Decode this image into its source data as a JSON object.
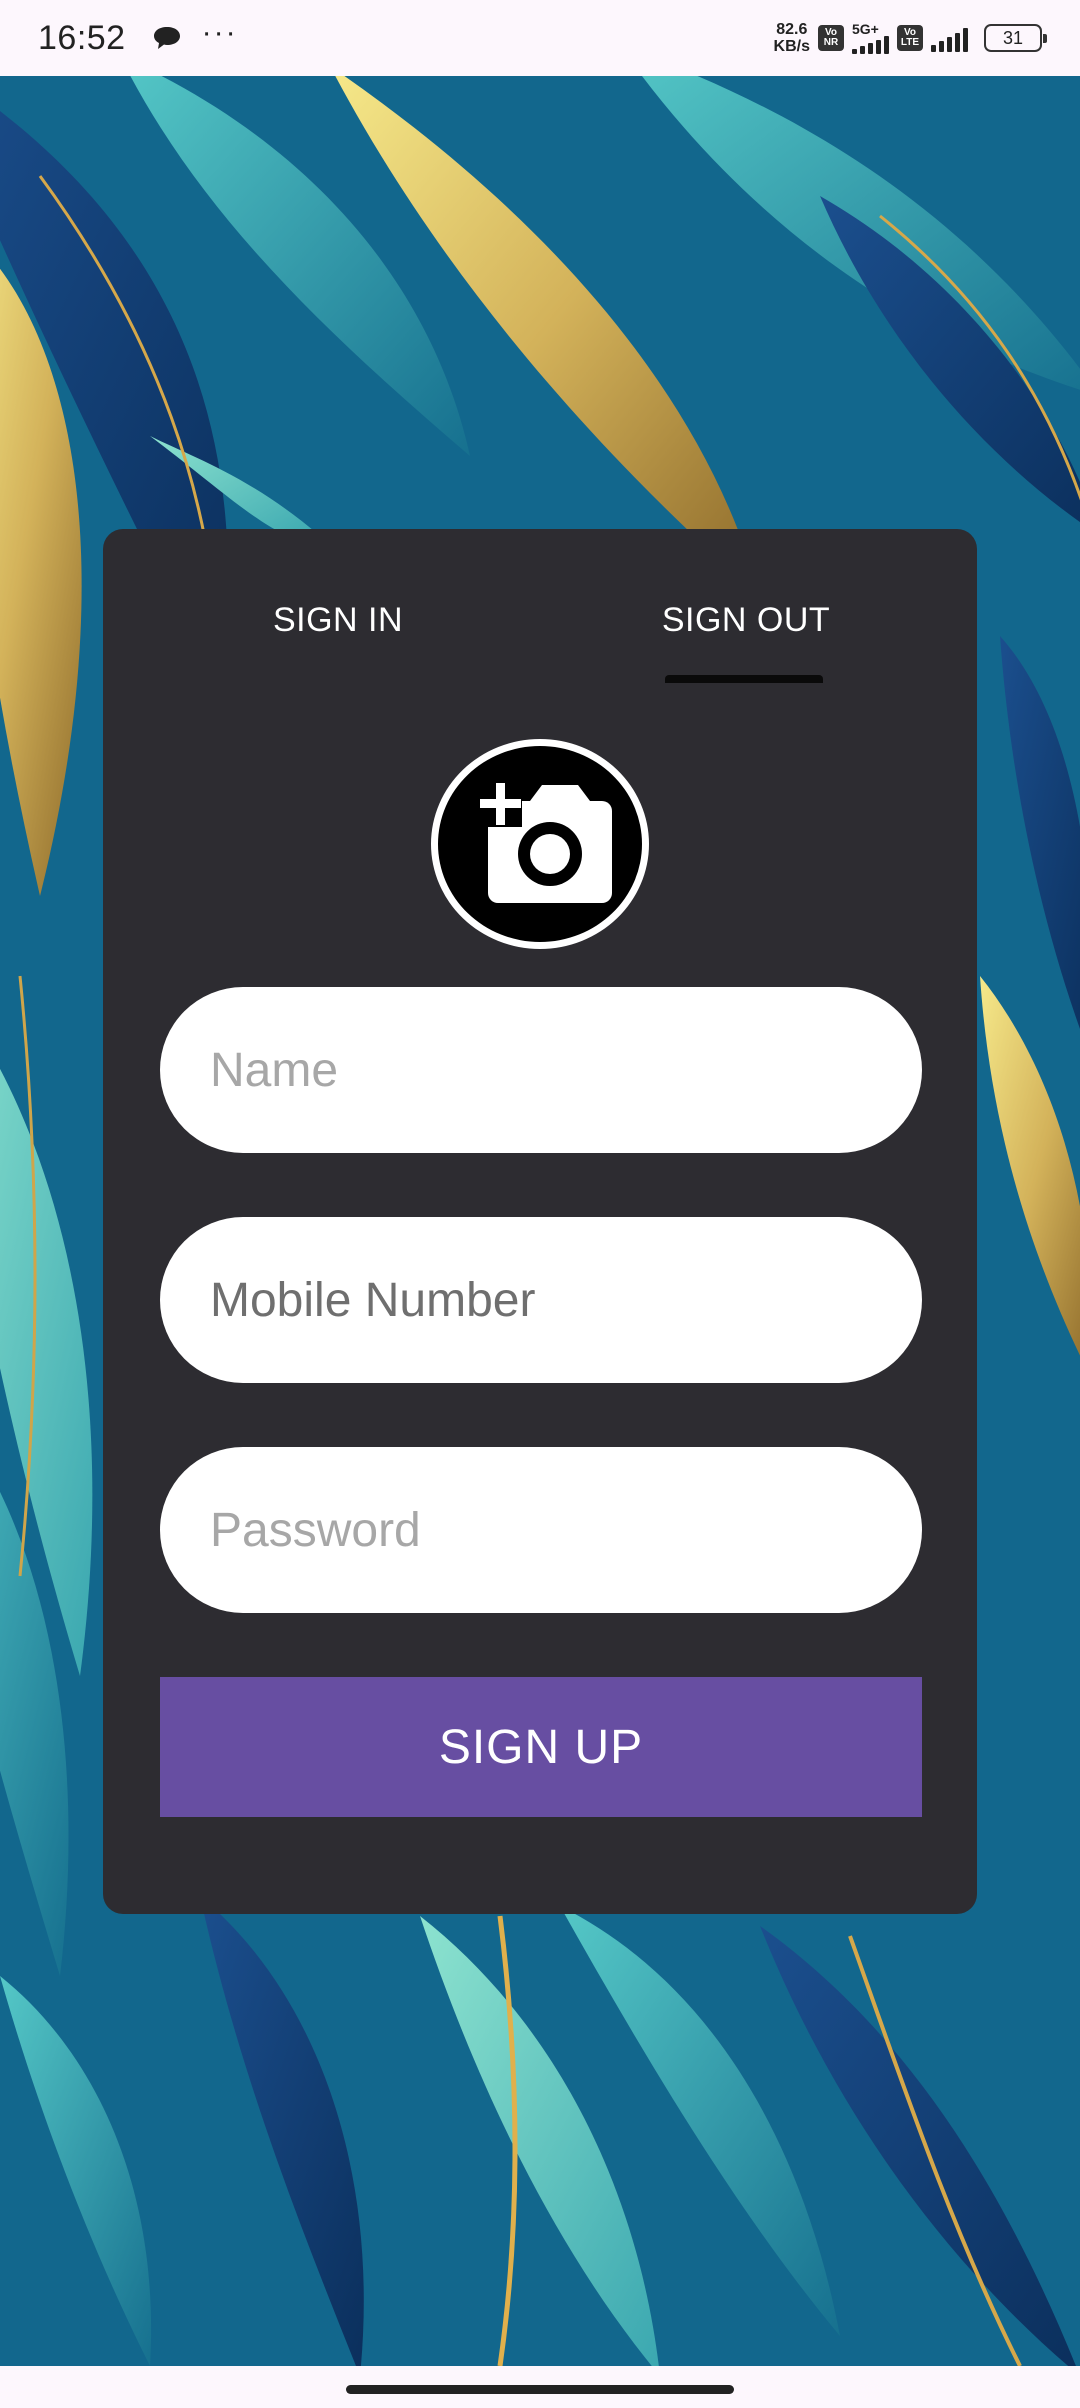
{
  "status_bar": {
    "time": "16:52",
    "more": "···",
    "net_speed_value": "82.6",
    "net_speed_unit": "KB/s",
    "tag_vonr_1": "Vo",
    "tag_vonr_2": "NR",
    "sig1_label": "5G+",
    "tag_volte_1": "Vo",
    "tag_volte_2": "LTE",
    "battery": "31"
  },
  "tabs": {
    "sign_in": "SIGN IN",
    "sign_out": "SIGN OUT",
    "active": "sign_out"
  },
  "form": {
    "name_placeholder": "Name",
    "mobile_placeholder": "Mobile Number",
    "password_placeholder": "Password",
    "submit_label": "SIGN UP"
  },
  "colors": {
    "card": "#2d2c31",
    "button": "#674ea2",
    "field": "#ffffff"
  },
  "icons": {
    "avatar": "camera-add-icon"
  }
}
